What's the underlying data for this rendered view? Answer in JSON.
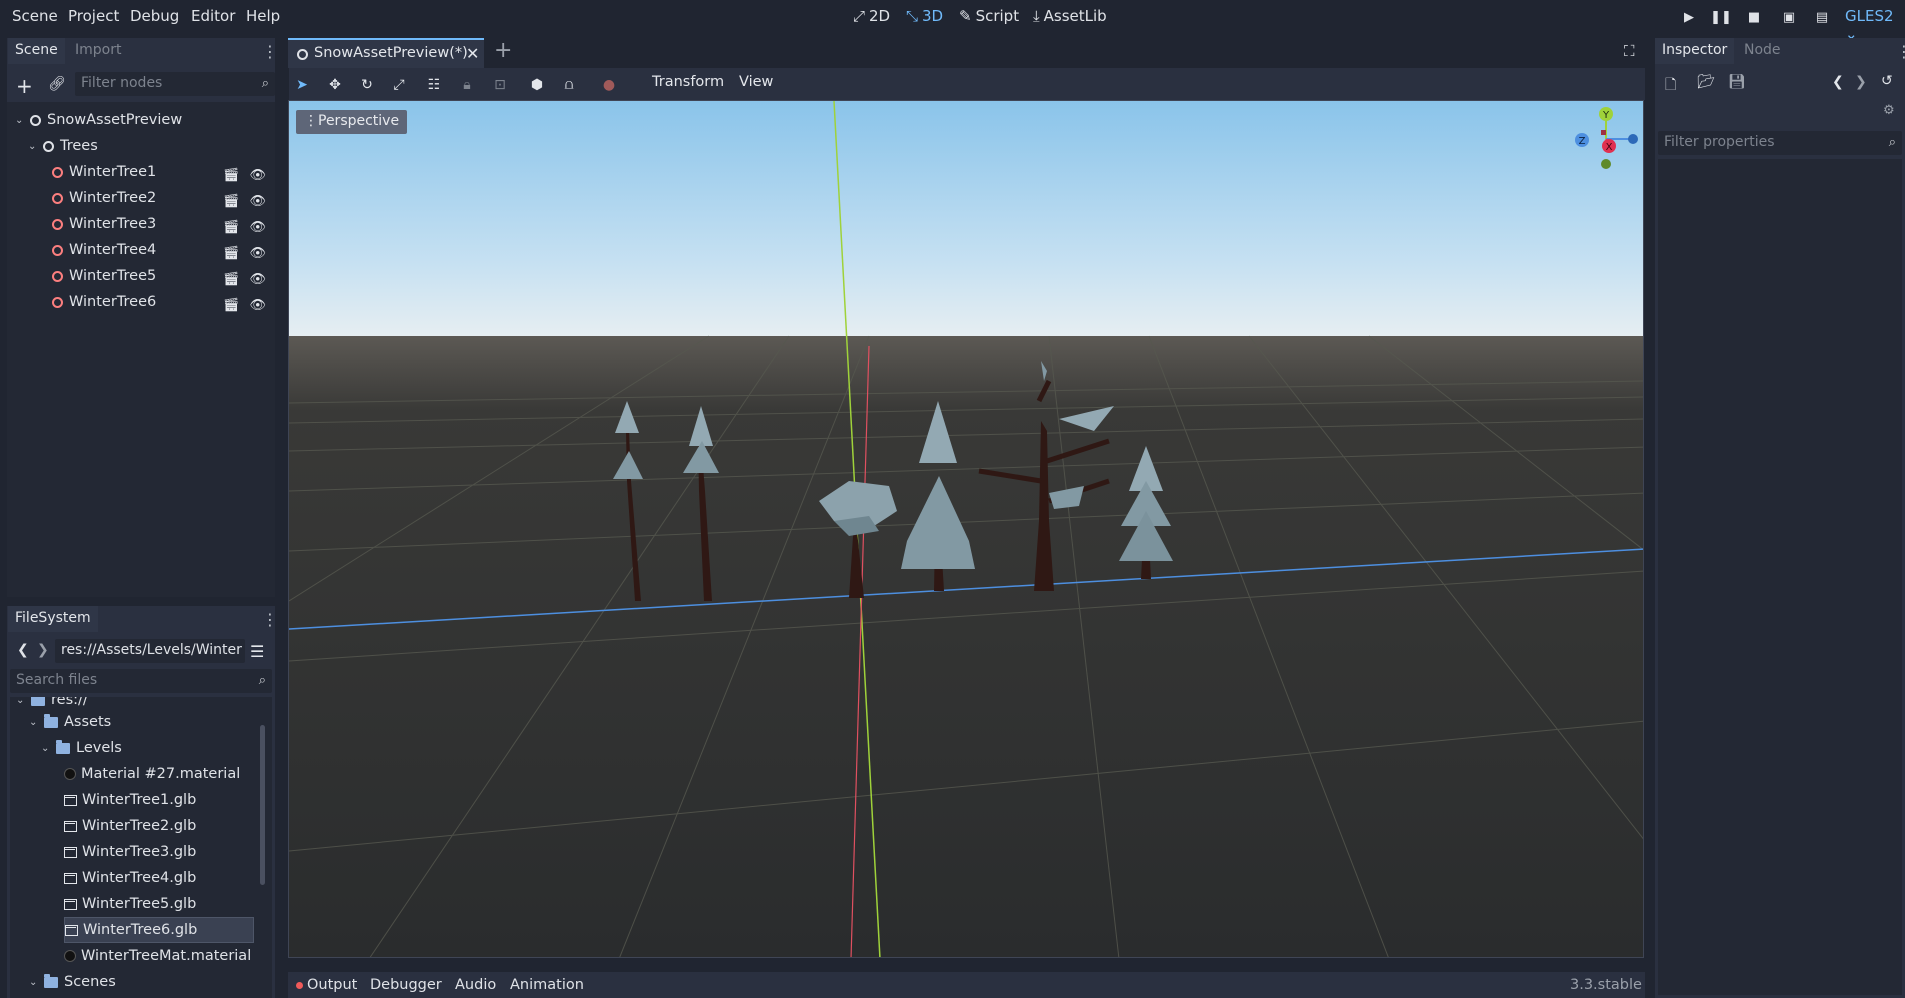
{
  "menubar": {
    "menus": [
      "Scene",
      "Project",
      "Debug",
      "Editor",
      "Help"
    ],
    "workspaces": [
      {
        "label": "2D",
        "icon": "2d-icon"
      },
      {
        "label": "3D",
        "icon": "3d-icon"
      },
      {
        "label": "Script",
        "icon": "script-icon"
      },
      {
        "label": "AssetLib",
        "icon": "assetlib-icon"
      }
    ],
    "renderer": "GLES2"
  },
  "scene_dock": {
    "tabs": [
      "Scene",
      "Import"
    ],
    "filter_placeholder": "Filter nodes",
    "root": "SnowAssetPreview",
    "group": "Trees",
    "nodes": [
      "WinterTree1",
      "WinterTree2",
      "WinterTree3",
      "WinterTree4",
      "WinterTree5",
      "WinterTree6"
    ]
  },
  "filesystem_dock": {
    "tab": "FileSystem",
    "path": "res://Assets/Levels/Winter",
    "search_placeholder": "Search files",
    "root_partial": "res://",
    "folders": [
      "Assets",
      "Levels",
      "Scenes"
    ],
    "files": [
      "Material #27.material",
      "WinterTree1.glb",
      "WinterTree2.glb",
      "WinterTree3.glb",
      "WinterTree4.glb",
      "WinterTree5.glb",
      "WinterTree6.glb",
      "WinterTreeMat.material"
    ],
    "selected_file": "WinterTree6.glb"
  },
  "editor": {
    "scene_tab": "SnowAssetPreview(*)",
    "toolbar_menus": [
      "Transform",
      "View"
    ],
    "viewport_label": "Perspective",
    "gizmo": {
      "x": "X",
      "y": "Y",
      "z": "Z"
    }
  },
  "inspector": {
    "tabs": [
      "Inspector",
      "Node"
    ],
    "filter_placeholder": "Filter properties"
  },
  "bottom_panel": {
    "tabs": [
      "Output",
      "Debugger",
      "Audio",
      "Animation"
    ],
    "version": "3.3.stable"
  },
  "colors": {
    "accent": "#70bafa",
    "panel": "#2a3040",
    "background": "#202531",
    "spatial_node": "#fc7f7f"
  }
}
